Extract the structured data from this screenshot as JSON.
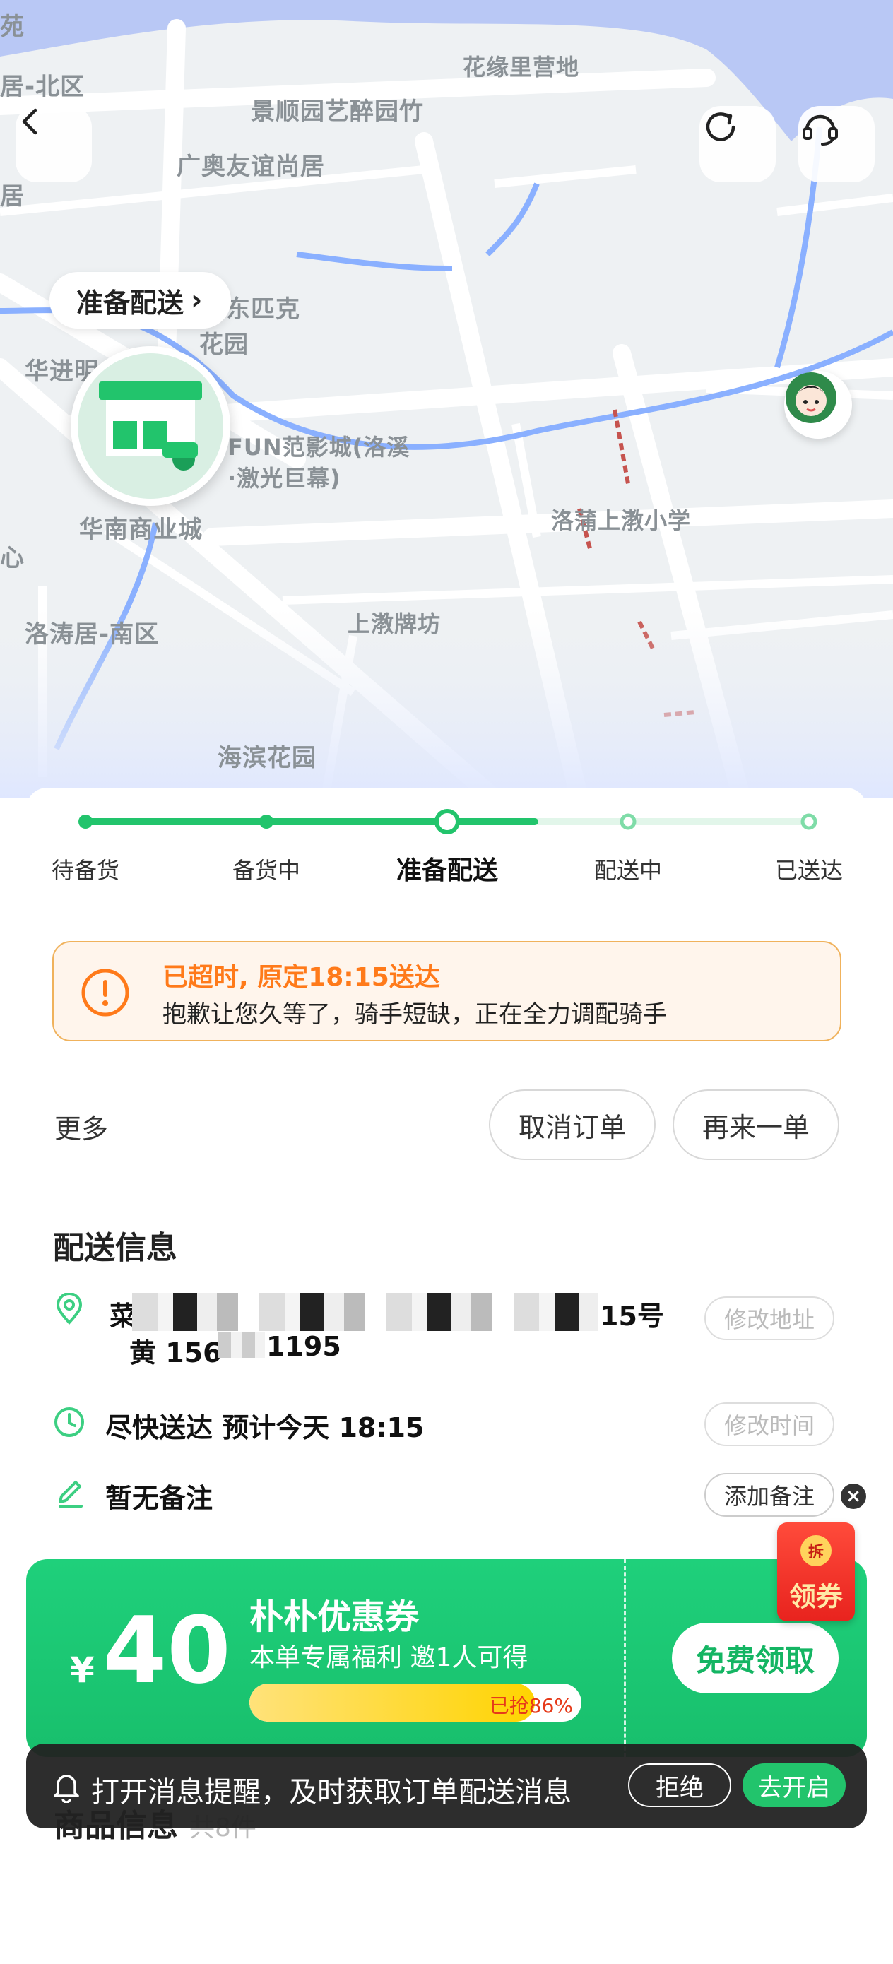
{
  "map": {
    "labels": [
      "花缘里营地",
      "景顺园艺醉园竹",
      "居-北区",
      "广奥友谊尚居",
      "居",
      "东匹克",
      "花园",
      "华进明",
      "FUN范影城(洛溪",
      "·激光巨幕)",
      "华南商业城",
      "心",
      "洛蒲上漖小学",
      "上漖牌坊",
      "洛涛居-南区",
      "海滨花园",
      "苑"
    ]
  },
  "header": {
    "back_icon": "chevron-left-icon",
    "refresh_icon": "refresh-icon",
    "service_icon": "headset-icon"
  },
  "status_pill": {
    "label": "准备配送",
    "chevron": "›"
  },
  "progress": {
    "steps": [
      {
        "label": "待备货",
        "state": "done"
      },
      {
        "label": "备货中",
        "state": "done"
      },
      {
        "label": "准备配送",
        "state": "current"
      },
      {
        "label": "配送中",
        "state": "pending"
      },
      {
        "label": "已送达",
        "state": "pending"
      }
    ],
    "accent": "#22c46c"
  },
  "alert": {
    "title": "已超时, 原定18:15送达",
    "message": "抱歉让您久等了，骑手短缺，正在全力调配骑手",
    "color": "#ff7a1a"
  },
  "actions": {
    "more_label": "更多",
    "cancel_label": "取消订单",
    "reorder_label": "再来一单"
  },
  "delivery": {
    "title": "配送信息",
    "address_prefix": "菜",
    "address_suffix": "15号",
    "contact_prefix": "黄 156",
    "contact_suffix": "1195",
    "edit_address_label": "修改地址",
    "time_text": "尽快送达 预计今天 18:15",
    "edit_time_label": "修改时间",
    "note_text": "暂无备注",
    "add_note_label": "添加备注"
  },
  "coupon": {
    "currency": "¥",
    "amount": "40",
    "title": "朴朴优惠券",
    "subtitle": "本单专属福利 邀1人可得",
    "progress_text": "已抢86%",
    "progress_value": 0.86,
    "claim_label": "免费领取"
  },
  "redpack": {
    "tear_label": "拆",
    "label": "领券",
    "close": "×"
  },
  "goods": {
    "title": "商品信息",
    "count": "共8件"
  },
  "notify": {
    "text": "打开消息提醒，及时获取订单配送消息",
    "refuse_label": "拒绝",
    "enable_label": "去开启",
    "bell_icon": "bell-icon"
  }
}
